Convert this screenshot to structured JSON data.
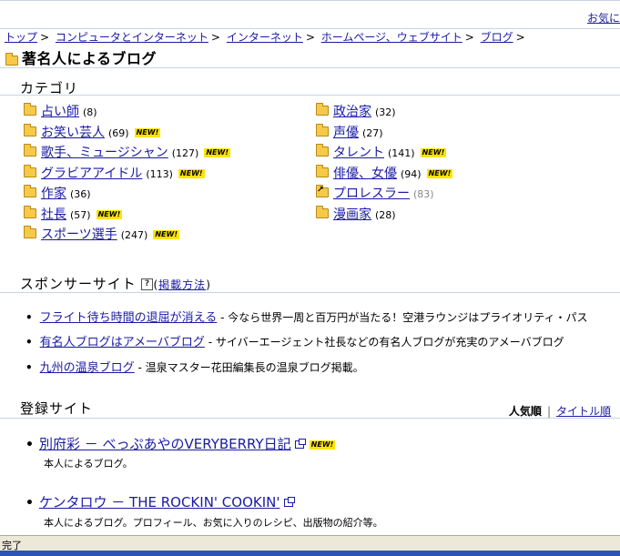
{
  "topbar": {
    "okini_label": "お気に"
  },
  "breadcrumb": {
    "items": [
      "トップ",
      "コンピュータとインターネット",
      "インターネット",
      "ホームページ、ウェブサイト",
      "ブログ"
    ],
    "separator": ">"
  },
  "page_title": "著名人によるブログ",
  "categories": {
    "heading": "カテゴリ",
    "new_badge": "NEW!",
    "left": [
      {
        "label": "占い師",
        "count": "(8)",
        "new": false
      },
      {
        "label": "お笑い芸人",
        "count": "(69)",
        "new": true
      },
      {
        "label": "歌手、ミュージシャン",
        "count": "(127)",
        "new": true
      },
      {
        "label": "グラビアアイドル",
        "count": "(113)",
        "new": true
      },
      {
        "label": "作家",
        "count": "(36)",
        "new": false
      },
      {
        "label": "社長",
        "count": "(57)",
        "new": true
      },
      {
        "label": "スポーツ選手",
        "count": "(247)",
        "new": true
      }
    ],
    "right": [
      {
        "label": "政治家",
        "count": "(32)",
        "new": false
      },
      {
        "label": "声優",
        "count": "(27)",
        "new": false
      },
      {
        "label": "タレント",
        "count": "(141)",
        "new": true
      },
      {
        "label": "俳優、女優",
        "count": "(94)",
        "new": true
      },
      {
        "label": "プロレスラー",
        "count": "(83)",
        "new": false,
        "shortcut": true
      },
      {
        "label": "漫画家",
        "count": "(28)",
        "new": false
      }
    ]
  },
  "sponsor": {
    "heading": "スポンサーサイト",
    "help_icon": "?",
    "paren_open": "(",
    "howto_label": "掲載方法",
    "paren_close": ")",
    "items": [
      {
        "link": "フライト待ち時間の退屈が消える",
        "text": " - 今なら世界一周と百万円が当たる！空港ラウンジはプライオリティ・パス"
      },
      {
        "link": "有名人ブログはアメーバブログ",
        "text": " - サイバーエージェント社長などの有名人ブログが充実のアメーバブログ"
      },
      {
        "link": "九州の温泉ブログ",
        "text": " - 温泉マスター花田編集長の温泉ブログ掲載。"
      }
    ]
  },
  "sites": {
    "heading": "登録サイト",
    "sort_popular": "人気順",
    "sort_separator": "|",
    "sort_title": "タイトル順",
    "items": [
      {
        "title": "別府彩 － べっぷあやのVERYBERRY日記",
        "new": true,
        "desc": "本人によるブログ。"
      },
      {
        "title": "ケンタロウ － THE ROCKIN' COOKIN'",
        "new": false,
        "desc": "本人によるブログ。プロフィール、お気に入りのレシピ、出版物の紹介等。"
      }
    ]
  },
  "status": {
    "text": "完了"
  },
  "colors": {
    "link": "#1a1aa6",
    "rule": "#c8d4e4",
    "new_badge": "#ffe400",
    "folder": "#f7c948"
  }
}
